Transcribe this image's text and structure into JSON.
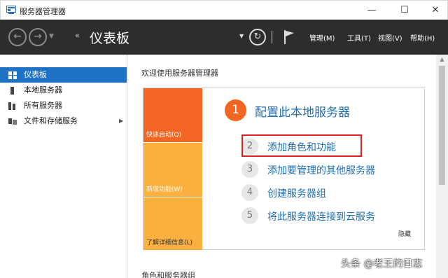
{
  "window": {
    "title": "服务器管理器",
    "minimize_glyph": "—",
    "maximize_glyph": "☐",
    "close_glyph": "✕"
  },
  "toolbar": {
    "back_glyph": "←",
    "forward_glyph": "→",
    "breadcrumb_arrows": "‹‹",
    "breadcrumb_title": "仪表板",
    "refresh_glyph": "↻",
    "menus": [
      "管理(M)",
      "工具(T)",
      "视图(V)",
      "帮助(H)"
    ]
  },
  "sidebar": {
    "items": [
      {
        "label": "仪表板",
        "icon": "dashboard-icon"
      },
      {
        "label": "本地服务器",
        "icon": "server-icon"
      },
      {
        "label": "所有服务器",
        "icon": "servers-icon"
      },
      {
        "label": "文件和存储服务",
        "icon": "storage-icon"
      }
    ],
    "expand_glyph": "▶"
  },
  "main": {
    "welcome_title": "欢迎使用服务器管理器",
    "tiles": [
      "快速启动(Q)",
      "新增功能(W)",
      "了解详细信息(L)"
    ],
    "step1": {
      "number": "1",
      "text": "配置此本地服务器"
    },
    "steps": [
      {
        "number": "2",
        "text": "添加角色和功能"
      },
      {
        "number": "3",
        "text": "添加要管理的其他服务器"
      },
      {
        "number": "4",
        "text": "创建服务器组"
      },
      {
        "number": "5",
        "text": "将此服务器连接到云服务"
      }
    ],
    "hide_label": "隐藏",
    "section2_title": "角色和服务器组"
  },
  "watermark": "头条 @老王的日志",
  "colors": {
    "toolbar_bg": "#2d2d30",
    "sidebar_active": "#1f73c6",
    "quick_start_tile": "#f26522",
    "secondary_tile": "#fbb040",
    "link_blue": "#1f6fb5",
    "highlight_red": "#e32020"
  }
}
